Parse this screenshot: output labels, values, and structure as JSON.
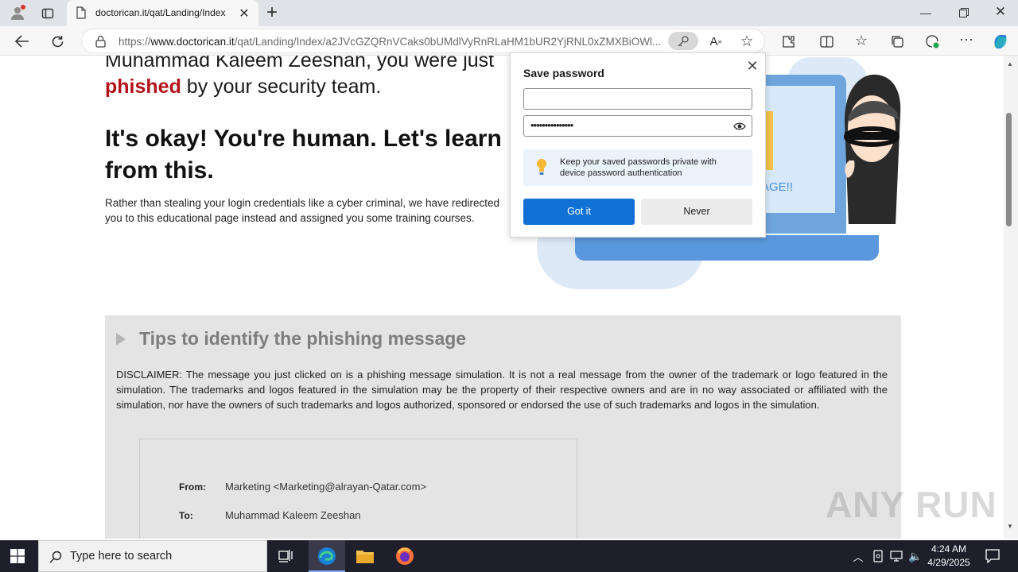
{
  "browser": {
    "tab_title": "doctorican.it/qat/Landing/Index",
    "new_tab": "+",
    "url_prefix": "https://",
    "url_domain": "www.doctorican.it",
    "url_rest": "/qat/Landing/Index/a2JVcGZQRnVCaks0bUMdlVyRnRLaHM1bUR2YjRNL0xZMXBiOWl...",
    "window_controls": [
      "minimize",
      "restore",
      "close"
    ]
  },
  "page": {
    "name_line": "Muhammad Kaleem Zeeshan, you were just",
    "phished_word": "phished",
    "phished_rest": " by your security team.",
    "headline": "It's okay! You're human. Let's learn from this.",
    "paragraph": "Rather than stealing your login credentials like a cyber criminal, we have redirected you to this educational page instead and assigned you some training courses.",
    "illustration_text": "AGE!!",
    "tips_title": "Tips to identify the phishing message",
    "disclaimer": "DISCLAIMER: The message you just clicked on is a phishing message simulation. It is not a real message from the owner of the trademark or logo featured in the simulation. The trademarks and logos featured in the simulation may be the property of their respective owners and are in no way associated or affiliated with the simulation, nor have the owners of such trademarks and logos authorized, sponsored or endorsed the use of such trademarks and logos in the simulation.",
    "mail": {
      "from_label": "From:",
      "from_value": "Marketing <Marketing@alrayan-Qatar.com>",
      "to_label": "To:",
      "to_value": "Muhammad Kaleem Zeeshan"
    }
  },
  "password_popup": {
    "title": "Save password",
    "username_value": "",
    "password_value": "•••••••••••••••",
    "info_text": "Keep your saved passwords private with device password authentication",
    "gotit_label": "Got it",
    "never_label": "Never"
  },
  "taskbar": {
    "search_placeholder": "Type here to search",
    "time": "4:24 AM",
    "date": "4/29/2025"
  },
  "watermark": "ANY RUN"
}
